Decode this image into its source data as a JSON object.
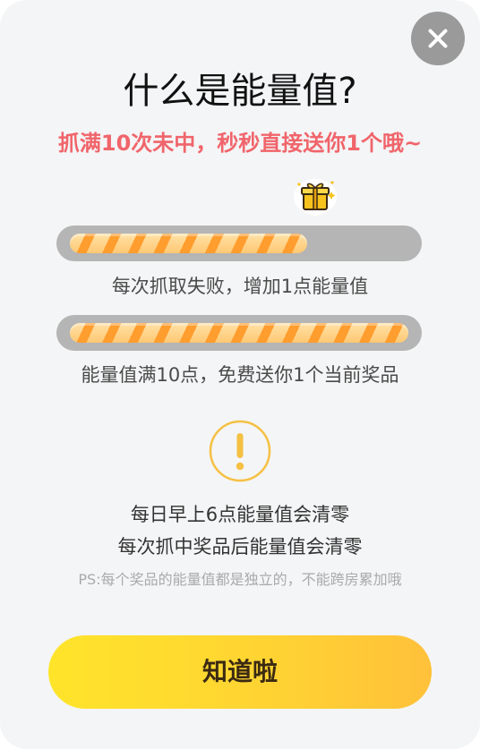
{
  "dialog": {
    "title": "什么是能量值?",
    "subtitle": "抓满10次未中，秒秒直接送你1个哦~",
    "close_icon": "close-icon",
    "progress_bars": [
      {
        "icon": "gift-icon",
        "progress": 0.7,
        "caption": "每次抓取失败，增加1点能量值"
      },
      {
        "progress": 1.0,
        "caption": "能量值满10点，免费送你1个当前奖品"
      }
    ],
    "warning_icon": "exclamation-icon",
    "notes": [
      "每日早上6点能量值会清零",
      "每次抓中奖品后能量值会清零"
    ],
    "ps": "PS:每个奖品的能量值都是独立的，不能跨房累加哦",
    "confirm_label": "知道啦",
    "colors": {
      "subtitle": "#f0656b",
      "button_start": "#ffe42a",
      "button_end": "#ffc13a",
      "progress_fill": "#ff9d2e",
      "warning": "#f5c043"
    }
  }
}
